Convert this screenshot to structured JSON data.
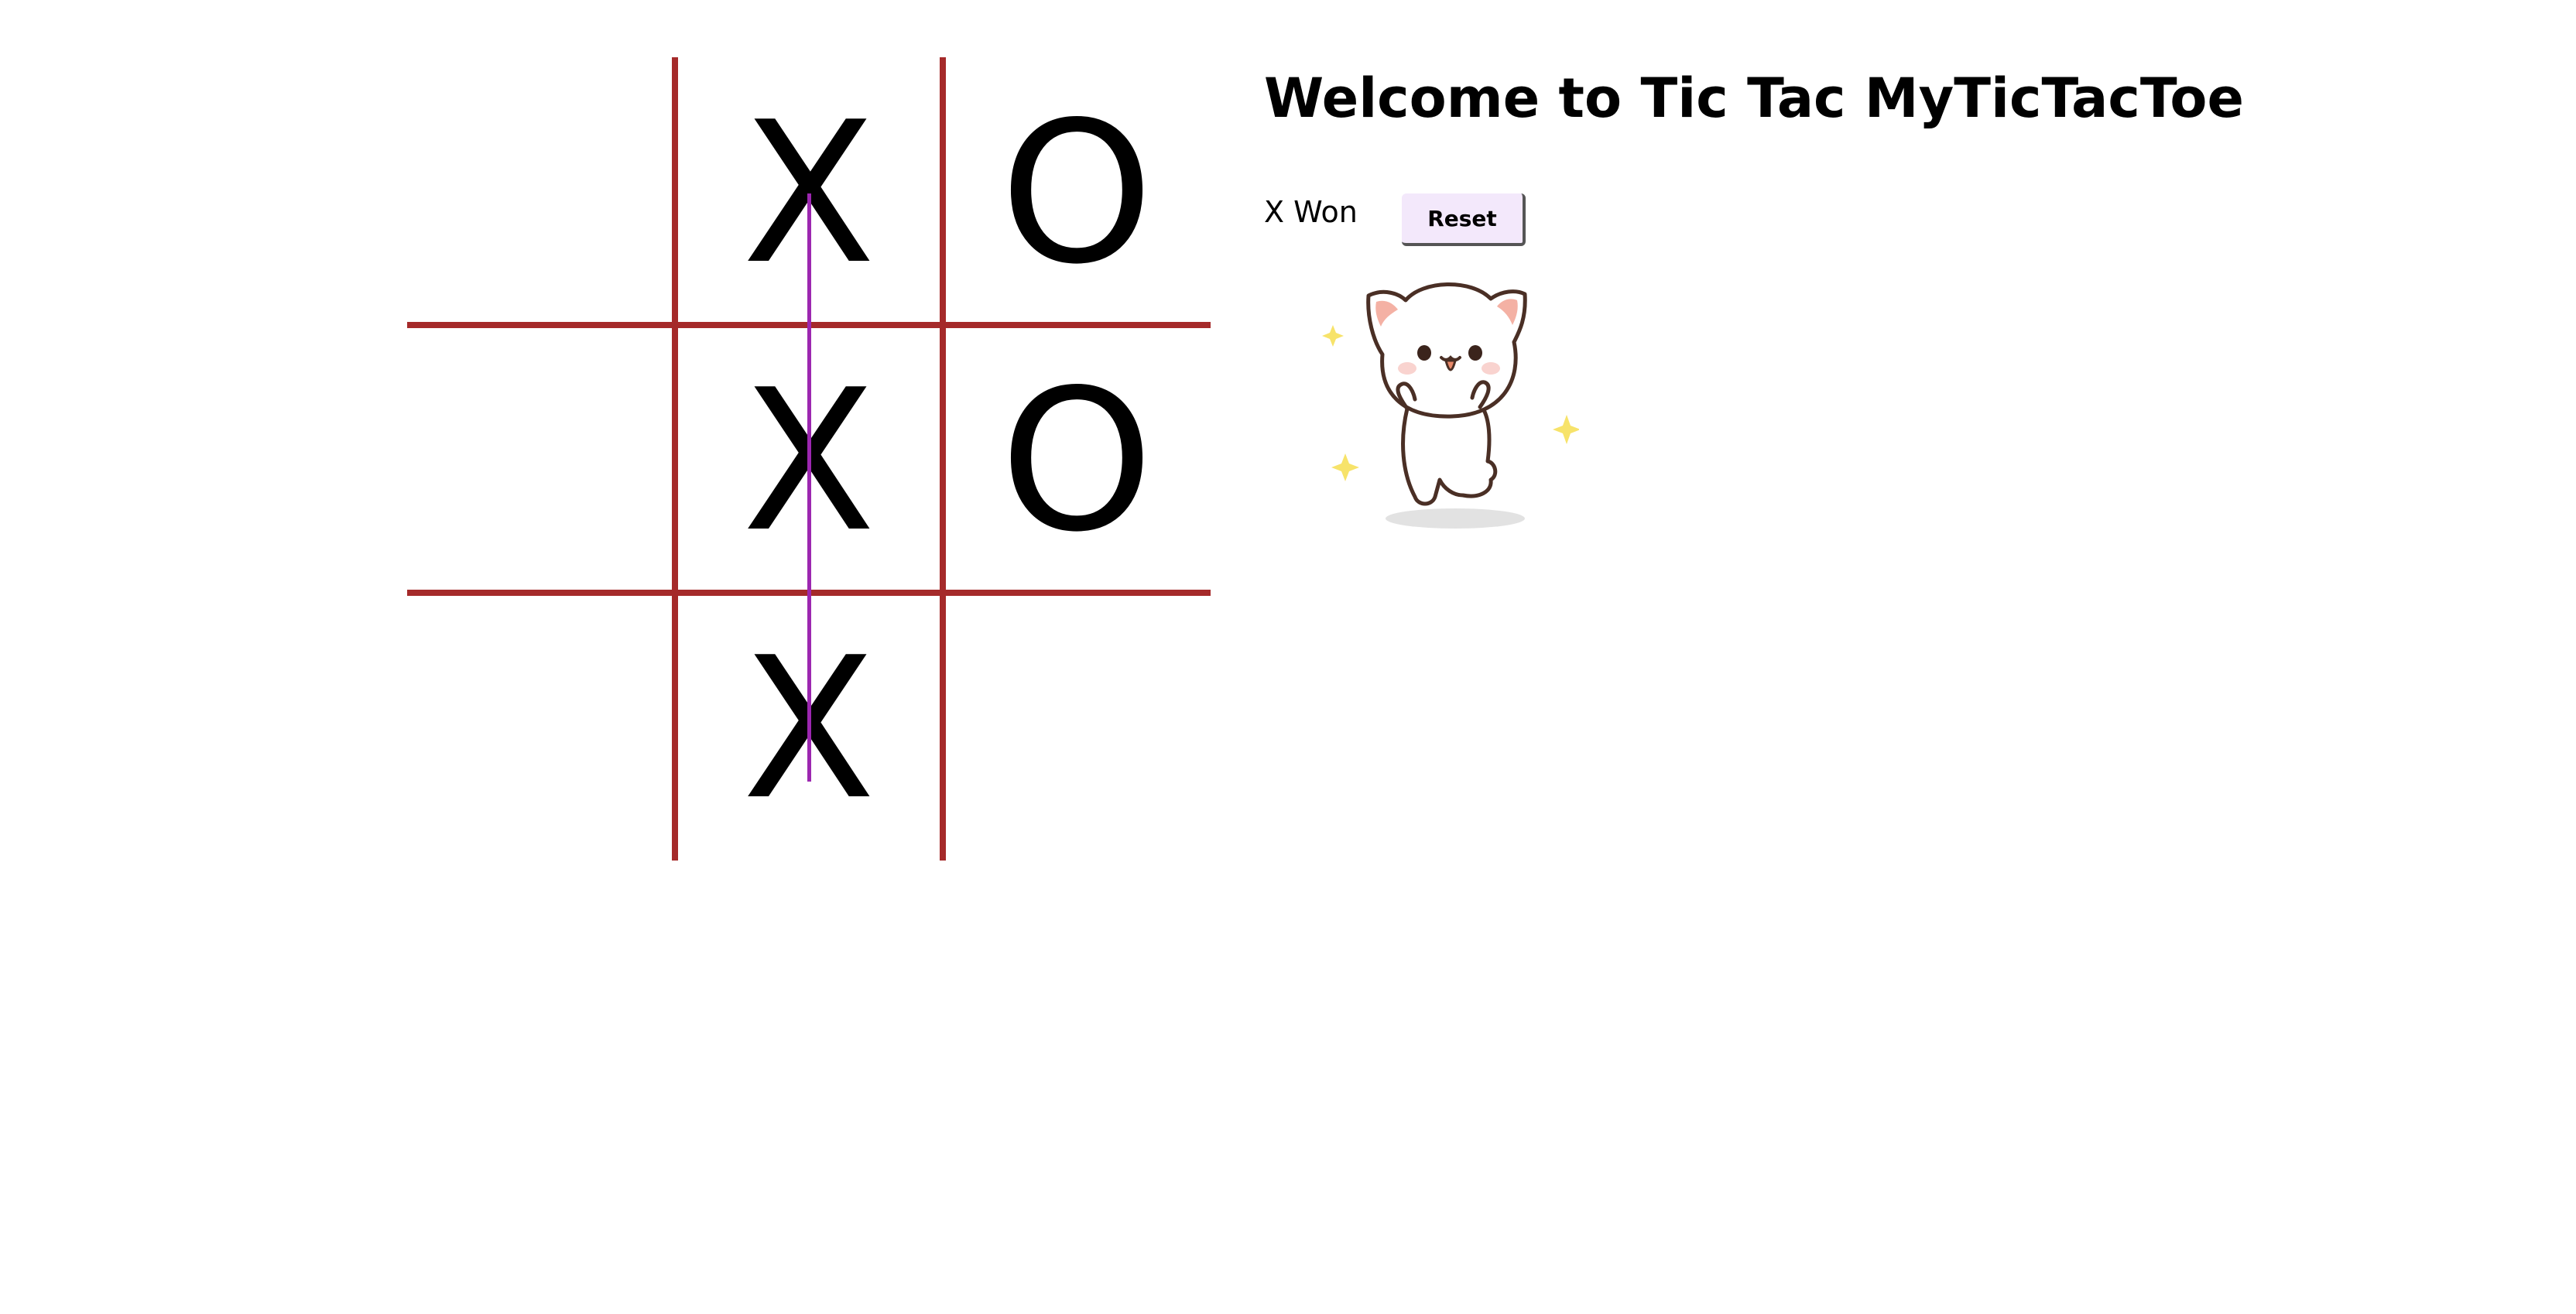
{
  "title": "Welcome to Tic Tac MyTicTacToe",
  "status": "X Won",
  "reset_label": "Reset",
  "board": [
    "",
    "X",
    "O",
    "",
    "X",
    "O",
    "",
    "X",
    ""
  ],
  "colors": {
    "grid": "#a52a2a",
    "win_line": "#9c27b0",
    "reset_bg": "#f3e8fb"
  },
  "celebration_image": "happy-cat-sticker"
}
